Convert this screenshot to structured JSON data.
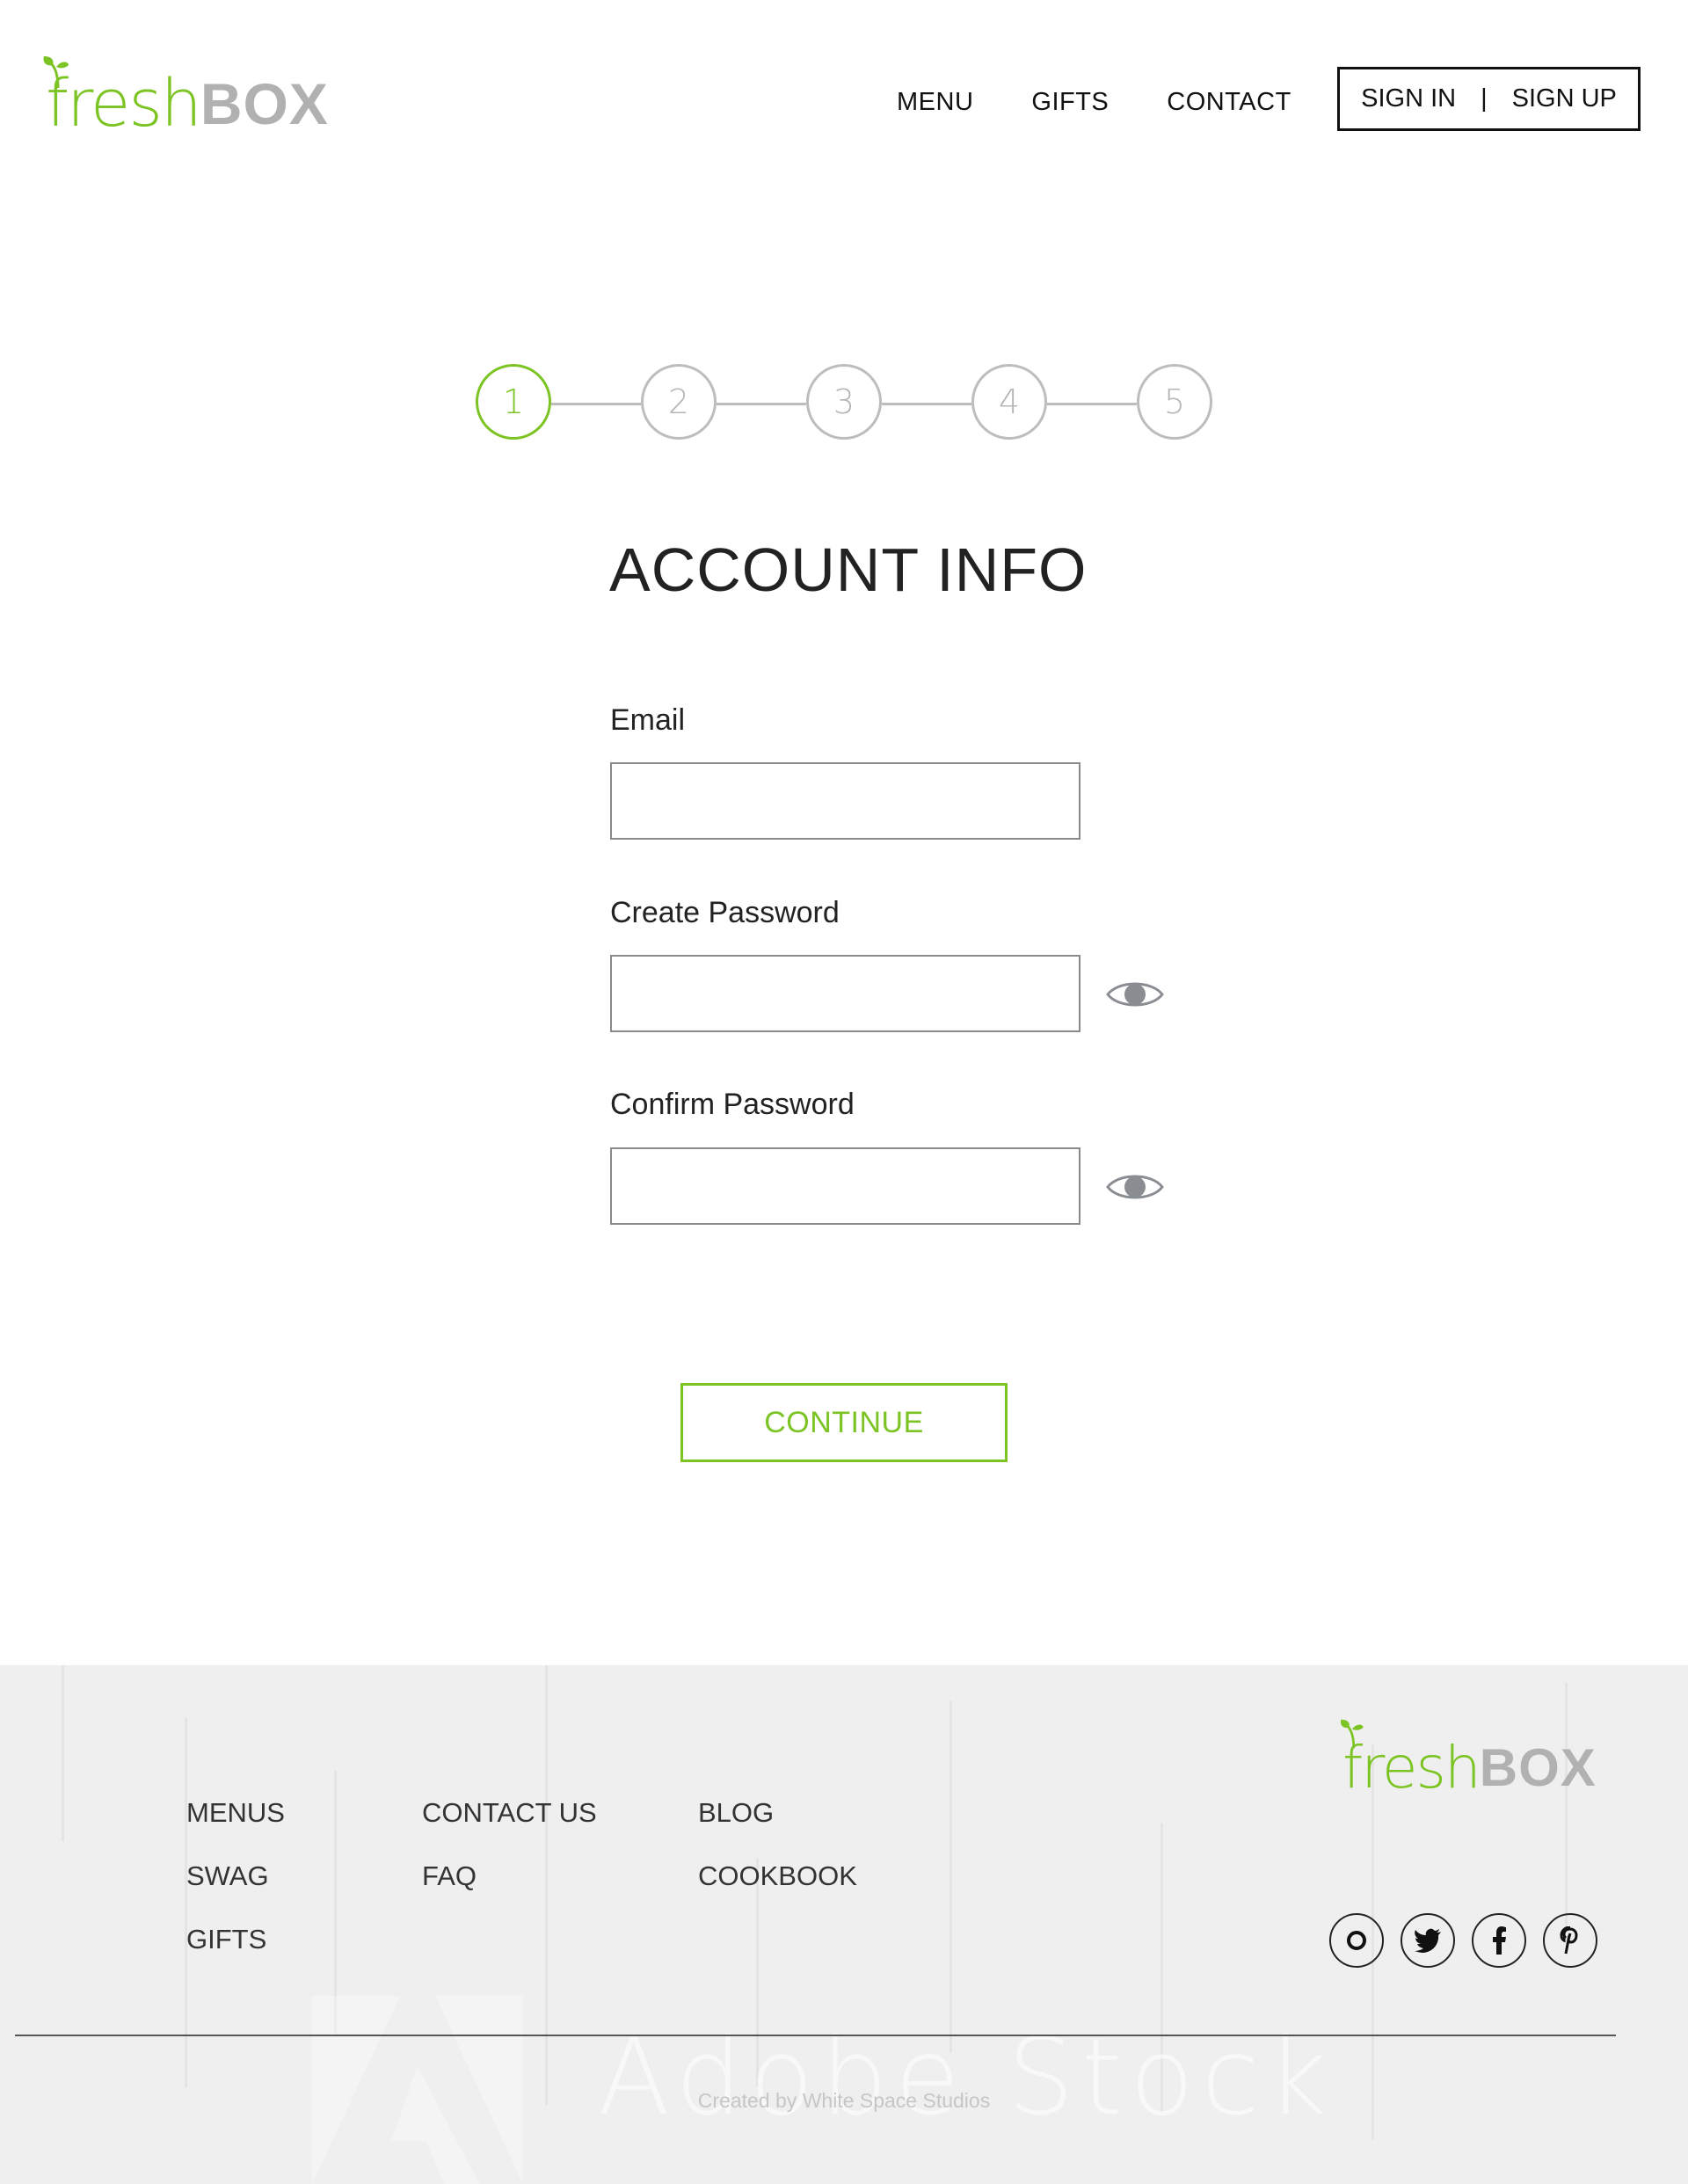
{
  "brand": {
    "name_part1": "fresh",
    "name_part2": "BOX",
    "green": "#7cc423",
    "gray": "#b1b1b1"
  },
  "header": {
    "nav": [
      "MENU",
      "GIFTS",
      "CONTACT"
    ],
    "sign_in": "SIGN IN",
    "separator": "|",
    "sign_up": "SIGN UP"
  },
  "stepper": {
    "steps": [
      "1",
      "2",
      "3",
      "4",
      "5"
    ],
    "active_step": 1,
    "active_color": "#7cc423",
    "inactive_color": "#bdbdbd"
  },
  "form": {
    "title": "ACCOUNT INFO",
    "email_label": "Email",
    "email_value": "",
    "create_password_label": "Create Password",
    "create_password_value": "",
    "confirm_password_label": "Confirm Password",
    "confirm_password_value": "",
    "show_password_icon": "eye-icon",
    "continue_label": "CONTINUE"
  },
  "footer": {
    "columns": [
      [
        "MENUS",
        "SWAG",
        "GIFTS"
      ],
      [
        "CONTACT US",
        "FAQ"
      ],
      [
        "BLOG",
        "COOKBOOK"
      ]
    ],
    "social": [
      "instagram-icon",
      "twitter-icon",
      "facebook-icon",
      "pinterest-icon"
    ],
    "watermark": "Adobe Stock",
    "credit": "Created by White Space Studios"
  }
}
